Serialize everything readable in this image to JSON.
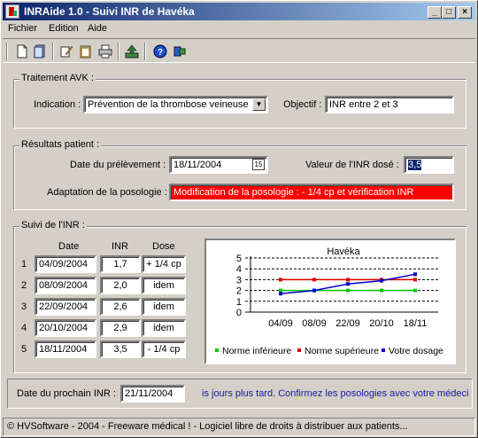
{
  "window": {
    "title": "INRAide 1.0 - Suivi INR de Havéka",
    "minimize_glyph": "_",
    "maximize_glyph": "□",
    "close_glyph": "×"
  },
  "menu": [
    {
      "label": "Fichier"
    },
    {
      "label": "Edition"
    },
    {
      "label": "Aide"
    }
  ],
  "toolbar": {
    "icons": [
      "new-icon",
      "open-icon",
      "edit-icon",
      "clipboard-icon",
      "print-icon",
      "export-icon",
      "help-icon",
      "info-icon"
    ]
  },
  "traitement": {
    "group_label": "Traitement AVK :",
    "indication_label": "Indication :",
    "indication_value": "Prévention de la thrombose veineuse",
    "objectif_label": "Objectif :",
    "objectif_value": "INR entre 2 et 3"
  },
  "resultats": {
    "group_label": "Résultats patient :",
    "date_label": "Date du prélèvement :",
    "date_value": "18/11/2004",
    "calendar_glyph": "15",
    "valeur_label": "Valeur de l'INR dosé :",
    "valeur_value": "3,5",
    "adaptation_label": "Adaptation de la posologie :",
    "adaptation_value": "Modification de la posologie : - 1/4 cp et vérification INR"
  },
  "suivi": {
    "group_label": "Suivi de l'INR :",
    "columns": [
      "Date",
      "INR",
      "Dose"
    ],
    "rows": [
      {
        "num": "1",
        "date": "04/09/2004",
        "inr": "1,7",
        "dose": "+ 1/4 cp"
      },
      {
        "num": "2",
        "date": "08/09/2004",
        "inr": "2,0",
        "dose": "idem"
      },
      {
        "num": "3",
        "date": "22/09/2004",
        "inr": "2,6",
        "dose": "idem"
      },
      {
        "num": "4",
        "date": "20/10/2004",
        "inr": "2,9",
        "dose": "idem"
      },
      {
        "num": "5",
        "date": "18/11/2004",
        "inr": "3,5",
        "dose": "- 1/4 cp"
      }
    ]
  },
  "colors": {
    "norme_inferieure": "#00cc00",
    "norme_superieure": "#e00000",
    "votre_dosage": "#0000cc",
    "alert": "#ff0000"
  },
  "chart_data": {
    "type": "line",
    "title": "Havéka",
    "categories": [
      "04/09",
      "08/09",
      "22/09",
      "20/10",
      "18/11"
    ],
    "y_ticks": [
      "0",
      "1",
      "2",
      "3",
      "4",
      "5"
    ],
    "ylim": [
      0,
      5
    ],
    "grid": "dashed horizontal",
    "legend_position": "bottom",
    "series": [
      {
        "name": "Norme inférieure",
        "color": "#00cc00",
        "values": [
          2,
          2,
          2,
          2,
          2
        ]
      },
      {
        "name": "Norme supérieure",
        "color": "#e00000",
        "values": [
          3,
          3,
          3,
          3,
          3
        ]
      },
      {
        "name": "Votre dosage",
        "color": "#0000cc",
        "values": [
          1.7,
          2.0,
          2.6,
          2.9,
          3.5
        ]
      }
    ]
  },
  "prochain": {
    "label": "Date du prochain INR :",
    "value": "21/11/2004",
    "scrolling_message": "is jours plus tard. Confirmez les posologies avec votre médecin"
  },
  "status": {
    "text": "© HVSoftware - 2004 - Freeware médical ! - Logiciel libre de droits à distribuer aux patients..."
  }
}
